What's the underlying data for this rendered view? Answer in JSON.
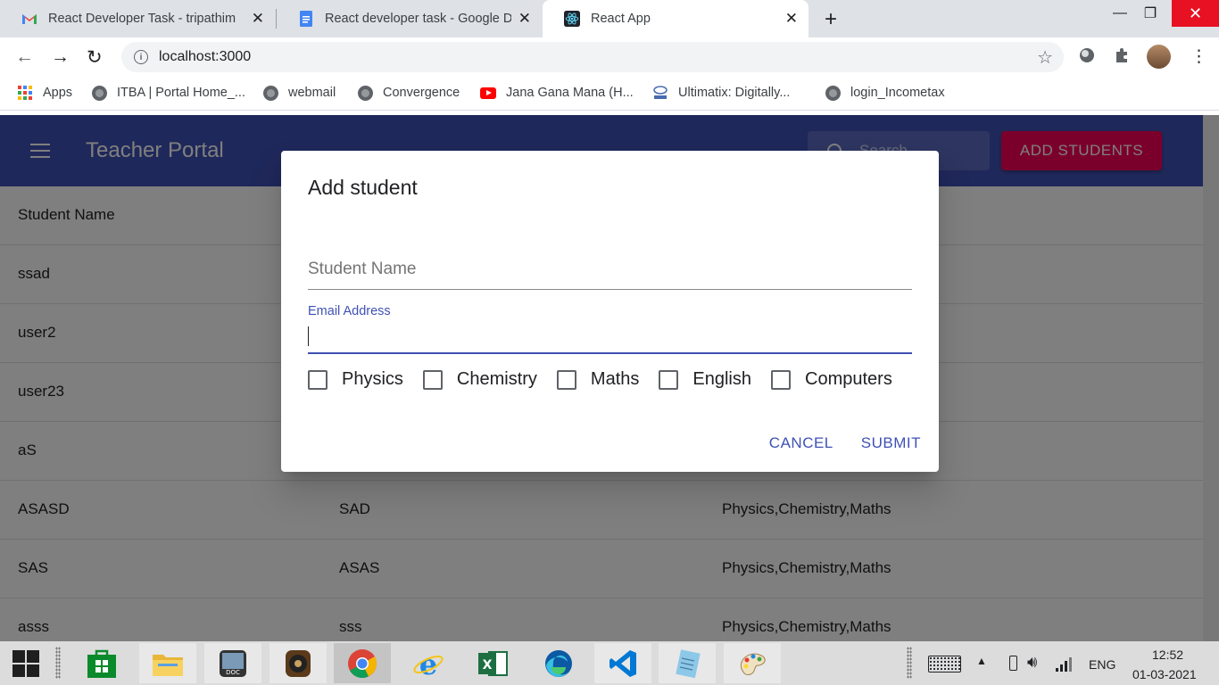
{
  "browser": {
    "tabs": [
      {
        "title": "React Developer Task - tripathim",
        "icon": "gmail-icon"
      },
      {
        "title": "React developer task - Google Dc",
        "icon": "google-docs-icon"
      },
      {
        "title": "React App",
        "icon": "react-icon"
      }
    ],
    "url": "localhost:3000",
    "bookmarks": [
      {
        "label": "Apps",
        "icon": "apps-grid-icon"
      },
      {
        "label": "ITBA | Portal Home_...",
        "icon": "globe-icon"
      },
      {
        "label": "webmail",
        "icon": "globe-icon"
      },
      {
        "label": "Convergence",
        "icon": "globe-icon"
      },
      {
        "label": "Jana Gana Mana (H...",
        "icon": "youtube-icon"
      },
      {
        "label": "Ultimatix: Digitally...",
        "icon": "tata-icon"
      },
      {
        "label": "login_Incometax",
        "icon": "globe-icon"
      }
    ]
  },
  "app": {
    "title": "Teacher Portal",
    "search_placeholder": "Search...",
    "add_button": "ADD STUDENTS",
    "table_header": "Student Name",
    "rows": [
      {
        "name": "ssad",
        "email": "",
        "subjects": ""
      },
      {
        "name": "user2",
        "email": "",
        "subjects": ""
      },
      {
        "name": "user23",
        "email": "",
        "subjects": ""
      },
      {
        "name": "aS",
        "email": "",
        "subjects": ""
      },
      {
        "name": "ASASD",
        "email": "SAD",
        "subjects": "Physics,Chemistry,Maths"
      },
      {
        "name": "SAS",
        "email": "ASAS",
        "subjects": "Physics,Chemistry,Maths"
      },
      {
        "name": "asss",
        "email": "sss",
        "subjects": "Physics,Chemistry,Maths"
      }
    ]
  },
  "dialog": {
    "title": "Add student",
    "name_placeholder": "Student Name",
    "email_label": "Email Address",
    "email_value": "",
    "subjects": [
      "Physics",
      "Chemistry",
      "Maths",
      "English",
      "Computers"
    ],
    "cancel": "CANCEL",
    "submit": "SUBMIT"
  },
  "taskbar": {
    "language": "ENG",
    "time": "12:52",
    "date": "01-03-2021"
  },
  "colors": {
    "primary": "#3f51b5",
    "secondary": "#f50057"
  }
}
